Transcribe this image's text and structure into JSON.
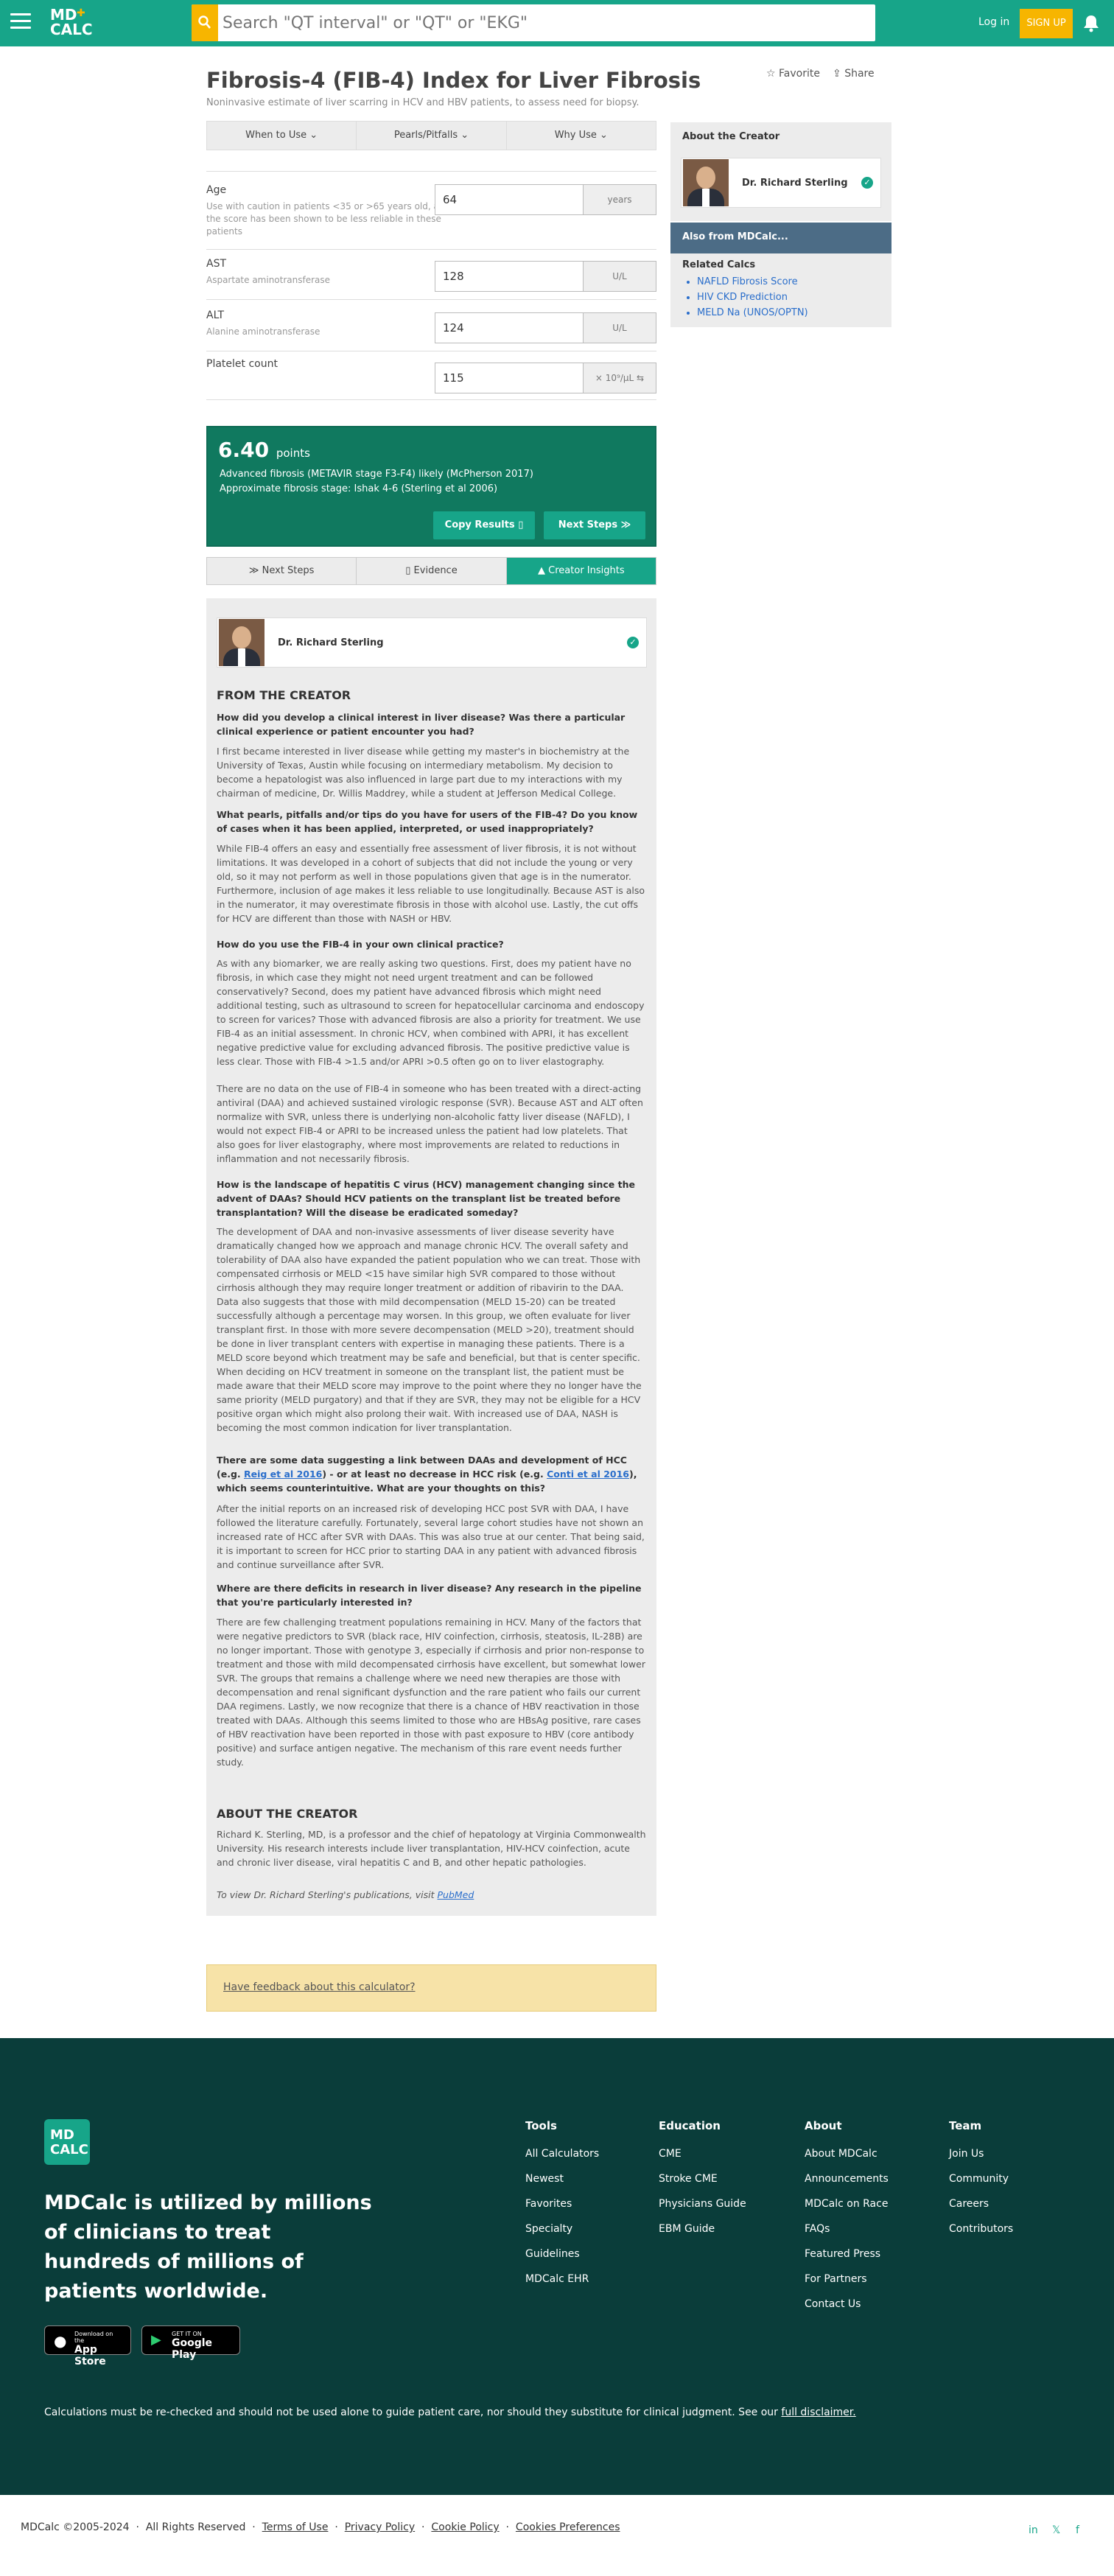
{
  "header": {
    "logo_line1": "MD",
    "logo_line2": "CALC",
    "search_placeholder": "Search \"QT interval\" or \"QT\" or \"EKG\"",
    "login": "Log in",
    "signup": "SIGN UP"
  },
  "page": {
    "title": "Fibrosis-4 (FIB-4) Index for Liver Fibrosis",
    "subtitle": "Noninvasive estimate of liver scarring in HCV and HBV patients, to assess need for biopsy.",
    "favorite": "Favorite",
    "share": "Share",
    "tabs": [
      "When to Use ⌄",
      "Pearls/Pitfalls ⌄",
      "Why Use ⌄"
    ]
  },
  "inputs": [
    {
      "label": "Age",
      "help": "Use with caution in patients <35 or >65 years old, as the score has been shown to be less reliable in these patients",
      "value": "64",
      "unit": "years"
    },
    {
      "label": "AST",
      "help": "Aspartate aminotransferase",
      "value": "128",
      "unit": "U/L"
    },
    {
      "label": "ALT",
      "help": "Alanine aminotransferase",
      "value": "124",
      "unit": "U/L"
    },
    {
      "label": "Platelet count",
      "help": "",
      "value": "115",
      "unit": "× 10⁹/µL ⇆"
    }
  ],
  "result": {
    "score": "6.40",
    "points": "points",
    "line1": "Advanced fibrosis (METAVIR stage F3-F4) likely (McPherson 2017)",
    "line2": "Approximate fibrosis stage: Ishak 4-6 (Sterling et al 2006)",
    "copy": "Copy Results ▯",
    "next": "Next Steps ≫"
  },
  "lower_tabs": [
    "≫ Next Steps",
    "▯ Evidence",
    "▲ Creator Insights"
  ],
  "creator": {
    "name": "Dr. Richard Sterling",
    "from_heading": "FROM THE CREATOR",
    "q1": "How did you develop a clinical interest in liver disease? Was there a particular clinical experience or patient encounter you had?",
    "a1": "I first became interested in liver disease while getting my master's in biochemistry at the University of Texas, Austin while focusing on intermediary metabolism. My decision to become a hepatologist was also influenced in large part due to my interactions with my chairman of medicine, Dr. Willis Maddrey, while a student at Jefferson Medical College.",
    "q2": "What pearls, pitfalls and/or tips do you have for users of the FIB-4? Do you know of cases when it has been applied, interpreted, or used inappropriately?",
    "a2": "While FIB-4 offers an easy and essentially free assessment of liver fibrosis, it is not without limitations. It was developed in a cohort of subjects that did not include the young or very old, so it may not perform as well in those populations given that age is in the numerator. Furthermore, inclusion of age makes it less reliable to use longitudinally.  Because AST is also in the numerator, it may overestimate fibrosis in those with alcohol use. Lastly, the cut offs for HCV are different than those with NASH or HBV.",
    "q3": "How do you use the FIB-4 in your own clinical practice?",
    "a3a": "As with any biomarker, we are really asking two questions. First, does my patient have no fibrosis, in which case they might not need urgent treatment and can be followed conservatively? Second, does my patient have advanced fibrosis which might need additional testing, such as ultrasound to screen for hepatocellular carcinoma and endoscopy to screen for varices? Those with advanced fibrosis are also a priority for treatment. We use FIB-4 as an initial assessment. In chronic HCV, when combined with APRI, it has excellent negative predictive value for excluding advanced fibrosis. The positive predictive value is less clear.  Those with FIB-4 >1.5 and/or APRI >0.5 often go on to liver elastography.",
    "a3b": "There are no data on the use of FIB-4 in someone who has been treated with a direct-acting antiviral (DAA) and achieved sustained virologic response (SVR). Because AST and ALT often normalize with SVR, unless there is underlying non-alcoholic fatty liver disease (NAFLD), I would not expect FIB-4 or APRI to be increased unless the patient had low platelets. That also goes for liver elastography, where most improvements are related to reductions in inflammation and not necessarily fibrosis.",
    "q4": "How is the landscape of hepatitis C virus (HCV) management changing since the advent of DAAs? Should HCV patients on the transplant list be treated before transplantation? Will the disease be eradicated someday?",
    "a4": "The development of DAA and non-invasive assessments of liver disease severity have dramatically changed how we approach and manage chronic HCV. The overall safety and tolerability of DAA also have expanded the patient population who we can treat. Those with compensated cirrhosis or MELD <15 have similar high SVR compared to those without cirrhosis although they may require longer treatment or addition of ribavirin to the DAA. Data also suggests that those with mild decompensation (MELD 15-20) can be treated successfully although a percentage may worsen. In this group, we often evaluate for liver transplant first.  In those with more severe decompensation (MELD >20), treatment should be done in liver transplant centers with expertise in managing these patients. There is a MELD score beyond which treatment may be safe and beneficial, but that is center specific. When deciding on HCV treatment in someone on the transplant list, the patient must be made aware that their MELD score may improve to the point where they no longer have the same priority (MELD purgatory) and that if they are SVR, they may not be eligible for a HCV positive organ which might also prolong their wait. With increased use of DAA, NASH is becoming the most common indication for liver transplantation.",
    "q5_pre": "There are some data suggesting a link between DAAs and development of HCC (e.g. ",
    "q5_link1": "Reig et al 2016",
    "q5_mid": ") - or at least no decrease in HCC risk (e.g. ",
    "q5_link2": "Conti et al 2016",
    "q5_post": "), which seems counterintuitive. What are your thoughts on this?",
    "a5": "After the initial reports on an increased risk of developing HCC post SVR with DAA, I have followed the literature carefully.  Fortunately, several large cohort studies have not shown an increased rate of HCC after SVR with DAAs. This was also true at our center. That being said, it is important to screen for HCC prior to starting DAA in any patient with advanced fibrosis and continue surveillance after SVR.",
    "q6": "Where are there deficits in research in liver disease? Any research in the pipeline that you're particularly interested in?",
    "a6": "There are few challenging treatment populations remaining in HCV.  Many of the factors that were negative predictors to SVR (black race, HIV coinfection, cirrhosis, steatosis, IL-28B) are no longer important. Those with genotype 3, especially if cirrhosis and prior non-response to treatment and those with mild decompensated cirrhosis have excellent, but somewhat lower SVR. The groups that remains a challenge where we need new therapies are those with decompensation and renal significant dysfunction and the rare patient who fails our current DAA regimens. Lastly, we now recognize that there is a chance of HBV reactivation in those treated with DAAs. Although this seems limited to those who are HBsAg positive, rare cases of HBV reactivation have been reported in those with past exposure to HBV (core antibody positive) and surface antigen negative.  The mechanism of this rare event needs further study.",
    "about_heading": "ABOUT THE CREATOR",
    "bio": "Richard K. Sterling, MD, is a professor and the chief of hepatology at Virginia Commonwealth University. His research interests include liver transplantation, HIV-HCV coinfection, acute and chronic liver disease, viral hepatitis C and B, and other hepatic pathologies.",
    "pubs_pre": "To view Dr. Richard Sterling's publications, visit ",
    "pubs_link": "PubMed"
  },
  "sidebar": {
    "about_heading": "About the Creator",
    "creator_name": "Dr. Richard Sterling",
    "also_heading": "Also from MDCalc...",
    "related_heading": "Related Calcs",
    "related": [
      "NAFLD Fibrosis Score",
      "HIV CKD Prediction",
      "MELD Na (UNOS/OPTN)"
    ]
  },
  "feedback": "Have feedback about this calculator?",
  "footer": {
    "logo_line1": "MD",
    "logo_line2": "CALC",
    "headline": "MDCalc is utilized by millions of clinicians to treat hundreds of millions of patients worldwide.",
    "appstore_small": "Download on the",
    "appstore": "App Store",
    "gplay_small": "GET IT ON",
    "gplay": "Google Play",
    "cols": [
      {
        "heading": "Tools",
        "items": [
          "All Calculators",
          "Newest",
          "Favorites",
          "Specialty",
          "Guidelines",
          "MDCalc EHR"
        ]
      },
      {
        "heading": "Education",
        "items": [
          "CME",
          "Stroke CME",
          "Physicians Guide",
          "EBM Guide"
        ]
      },
      {
        "heading": "About",
        "items": [
          "About MDCalc",
          "Announcements",
          "MDCalc on Race",
          "FAQs",
          "Featured Press",
          "For Partners",
          "Contact Us"
        ]
      },
      {
        "heading": "Team",
        "items": [
          "Join Us",
          "Community",
          "Careers",
          "Contributors"
        ]
      }
    ],
    "disclaimer": "Calculations must be re-checked and should not be used alone to guide patient care, nor should they substitute for clinical judgment. See our ",
    "disclaimer_link": "full disclaimer."
  },
  "bottom": {
    "copyright": "MDCalc ©2005-2024",
    "rights": "All Rights Reserved",
    "terms": "Terms of Use",
    "privacy": "Privacy Policy",
    "cookie": "Cookie Policy",
    "cookie_prefs": "Cookies Preferences",
    "social": [
      "in",
      "𝕏",
      "f"
    ]
  },
  "colors": {
    "brand": "#17a589",
    "accent": "#f7b500",
    "result": "#10795f",
    "footer": "#0a3d3a"
  }
}
